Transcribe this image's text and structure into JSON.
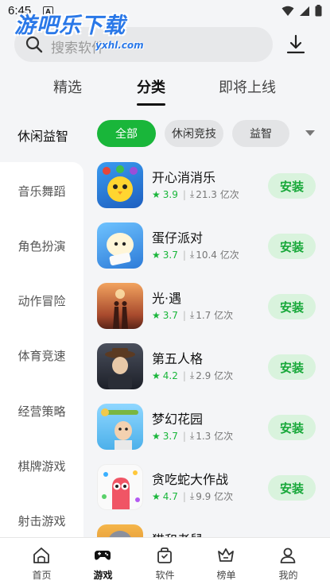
{
  "status": {
    "time": "6:45",
    "notification": "A"
  },
  "watermark": {
    "text": "游吧乐下载",
    "sub": "yxhl.com"
  },
  "search": {
    "placeholder": "搜索软件"
  },
  "top_tabs": [
    {
      "label": "精选"
    },
    {
      "label": "分类"
    },
    {
      "label": "即将上线"
    }
  ],
  "category": {
    "title": "休闲益智",
    "chips": [
      {
        "label": "全部"
      },
      {
        "label": "休闲竞技"
      },
      {
        "label": "益智"
      }
    ]
  },
  "sidebar": {
    "items": [
      {
        "label": "音乐舞蹈"
      },
      {
        "label": "角色扮演"
      },
      {
        "label": "动作冒险"
      },
      {
        "label": "体育竞速"
      },
      {
        "label": "经营策略"
      },
      {
        "label": "棋牌游戏"
      },
      {
        "label": "射击游戏"
      }
    ]
  },
  "apps": [
    {
      "name": "开心消消乐",
      "rating": "3.9",
      "downloads": "21.3 亿次",
      "install": "安装"
    },
    {
      "name": "蛋仔派对",
      "rating": "3.7",
      "downloads": "10.4 亿次",
      "install": "安装"
    },
    {
      "name": "光·遇",
      "rating": "3.7",
      "downloads": "1.7 亿次",
      "install": "安装"
    },
    {
      "name": "第五人格",
      "rating": "4.2",
      "downloads": "2.9 亿次",
      "install": "安装"
    },
    {
      "name": "梦幻花园",
      "rating": "3.7",
      "downloads": "1.3 亿次",
      "install": "安装"
    },
    {
      "name": "贪吃蛇大作战",
      "rating": "4.7",
      "downloads": "9.9 亿次",
      "install": "安装"
    },
    {
      "name": "猫和老鼠",
      "rating": "",
      "downloads": "",
      "install": ""
    }
  ],
  "icons": {
    "search": "search-icon",
    "download": "download-icon",
    "home": "home-icon",
    "games": "gamepad-icon",
    "software": "bag-icon",
    "ranking": "crown-icon",
    "profile": "person-icon"
  },
  "colors": {
    "accent": "#19b63a",
    "install_bg": "#d9f3dd"
  },
  "bottom_nav": [
    {
      "label": "首页"
    },
    {
      "label": "游戏"
    },
    {
      "label": "软件"
    },
    {
      "label": "榜单"
    },
    {
      "label": "我的"
    }
  ]
}
